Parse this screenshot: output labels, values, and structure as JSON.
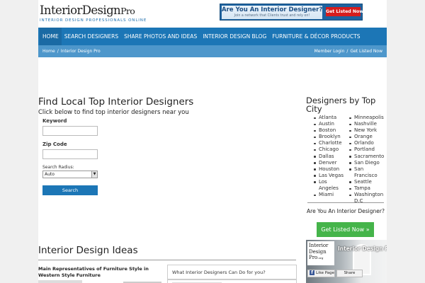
{
  "brand": {
    "logo_part1": "Interior",
    "logo_part2": "Design",
    "logo_part3": "Pro",
    "tagline": "INTERIOR DESIGN PROFESSIONALS ONLINE"
  },
  "top_cta": {
    "title": "Are You An Interior Designer?",
    "subtitle": "Join a network that Clients trust and rely on!",
    "button": "Get Listed Now!"
  },
  "nav": {
    "items": [
      {
        "label": "HOME"
      },
      {
        "label": "SEARCH DESIGNERS"
      },
      {
        "label": "SHARE PHOTOS AND IDEAS"
      },
      {
        "label": "INTERIOR DESIGN BLOG"
      },
      {
        "label": "FURNITURE & DÉCOR PRODUCTS"
      }
    ]
  },
  "breadcrumb": {
    "home": "Home",
    "separator": "/",
    "current": "Interior Design Pro"
  },
  "user_links": {
    "login": "Member Login",
    "separator": "/",
    "listed": "Get Listed Now"
  },
  "finder": {
    "title": "Find Local Top Interior Designers",
    "subtitle": "Click below to find top interior designers near you",
    "keyword_label": "Keyword",
    "keyword_value": "",
    "zip_label": "Zip Code",
    "zip_value": "",
    "radius_label": "Search Radius:",
    "radius_selected": "Auto",
    "search_button": "Search"
  },
  "sidebar": {
    "title": "Designers by Top City",
    "cities_col1": [
      "Atlanta",
      "Austin",
      "Boston",
      "Brooklyn",
      "Charlotte",
      "Chicago",
      "Dallas",
      "Denver",
      "Houston",
      "Las Vegas",
      "Los Angeles",
      "Miami"
    ],
    "cities_col2": [
      "Minneapolis",
      "Nashville",
      "New York",
      "Orange",
      "Orlando",
      "Portland",
      "Sacramento",
      "San Diego",
      "San Francisco",
      "Seattle",
      "Tampa",
      "Washington D.C"
    ],
    "cta_title": "Are You An Interior Designer?",
    "cta_button": "Get Listed Now »",
    "fb": {
      "logo_line1": "Interior",
      "logo_line2": "Design",
      "logo_line3": "Pro",
      "logo_suffix": ".org",
      "page_name": "Interior Design Pro",
      "like_label": "Like Page",
      "share_label": "Share"
    }
  },
  "ideas": {
    "title": "Interior Design Ideas",
    "article_title": "Main Representatives of Furniture Style in Western Style Furniture",
    "question": "What Interior Designers Can Do for you?"
  }
}
